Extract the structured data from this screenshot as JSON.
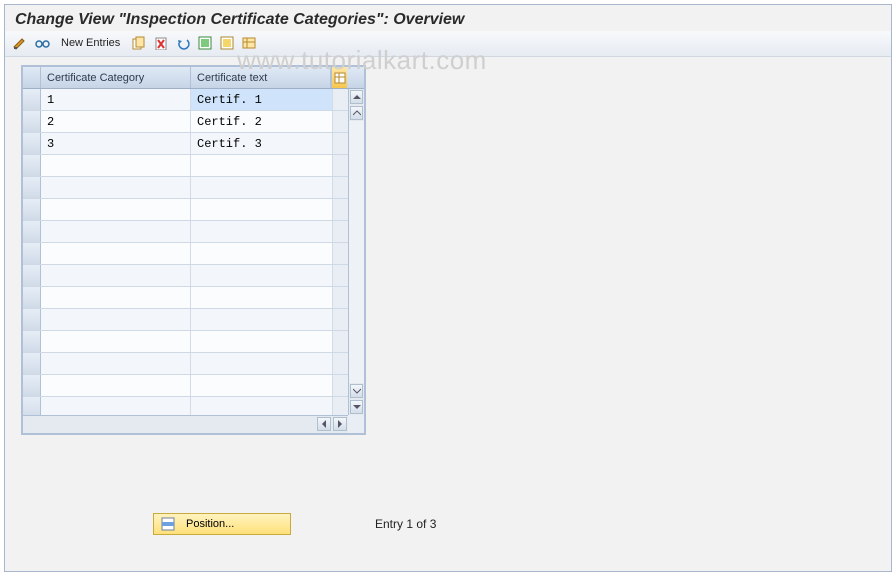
{
  "title": "Change View \"Inspection Certificate Categories\": Overview",
  "watermark": "www.tutorialkart.com",
  "toolbar": {
    "new_entries": "New Entries"
  },
  "table": {
    "columns": {
      "col1": "Certificate Category",
      "col2": "Certificate text"
    },
    "rows": [
      {
        "category": "1",
        "text": "Certif. 1"
      },
      {
        "category": "2",
        "text": "Certif. 2"
      },
      {
        "category": "3",
        "text": "Certif. 3"
      }
    ]
  },
  "footer": {
    "position_button": "Position...",
    "entry_status": "Entry 1 of 3"
  }
}
